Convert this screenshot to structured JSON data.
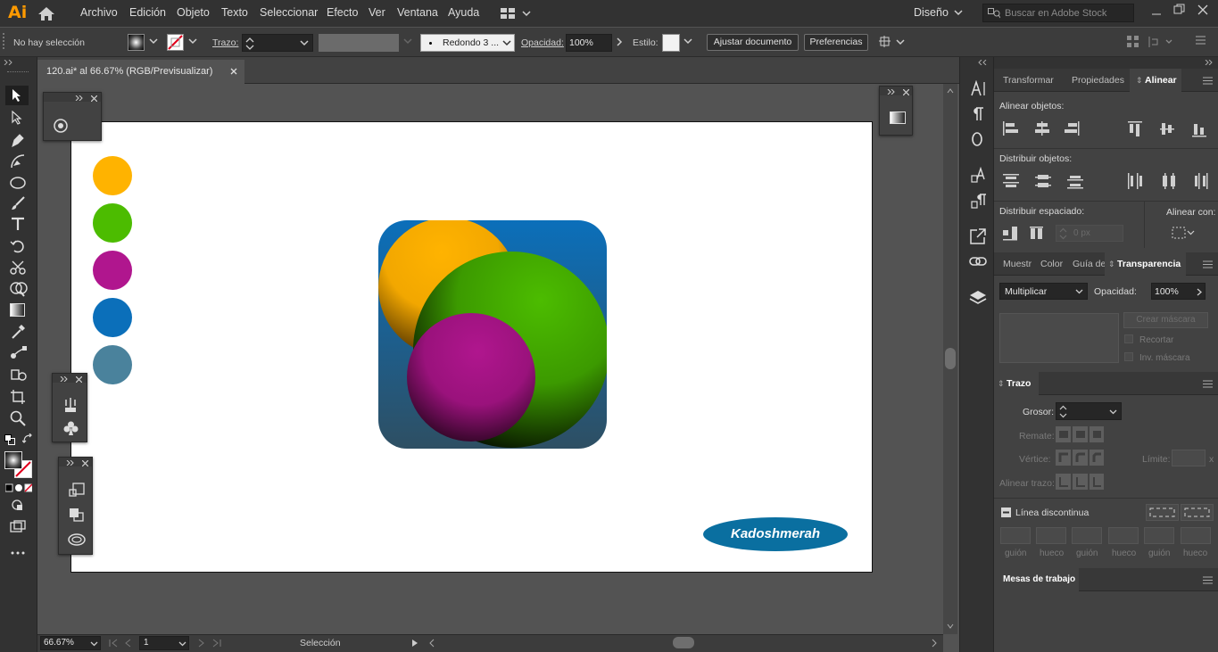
{
  "app": {
    "logo": "Ai"
  },
  "menu": [
    "Archivo",
    "Edición",
    "Objeto",
    "Texto",
    "Seleccionar",
    "Efecto",
    "Ver",
    "Ventana",
    "Ayuda"
  ],
  "workspace": "Diseño",
  "stock_search": {
    "placeholder": "Buscar en Adobe Stock"
  },
  "control": {
    "selection_status": "No hay selección",
    "stroke_label": "Trazo:",
    "brush": "Redondo 3 ...",
    "opacity_label": "Opacidad:",
    "opacity_value": "100%",
    "style_label": "Estilo:",
    "adjust_doc": "Ajustar documento",
    "preferences": "Preferencias"
  },
  "document": {
    "tab_title": "120.ai* al 66.67% (RGB/Previsualizar)"
  },
  "artwork": {
    "swatches": [
      "#ffb300",
      "#4cbc00",
      "#b0168e",
      "#0b6fba",
      "#4a829c"
    ],
    "signature": "Kadoshmerah"
  },
  "status": {
    "zoom": "66.67%",
    "artboard_num": "1",
    "tool": "Selección"
  },
  "panels": {
    "align_tabs": [
      "Transformar",
      "Propiedades",
      "Alinear"
    ],
    "align_objects": "Alinear objetos:",
    "distribute_objects": "Distribuir objetos:",
    "distribute_spacing": "Distribuir espaciado:",
    "align_to": "Alinear con:",
    "spacing_value": "0 px",
    "transp_tabs": [
      "Muestr",
      "Color",
      "Guía de",
      "Transparencia"
    ],
    "blend_mode": "Multiplicar",
    "opacity_label": "Opacidad:",
    "opacity_value": "100%",
    "make_mask": "Crear máscara",
    "clip": "Recortar",
    "invert_mask": "Inv. máscara",
    "stroke_tab": "Trazo",
    "weight_label": "Grosor:",
    "cap_label": "Remate:",
    "corner_label": "Vértice:",
    "limit_label": "Límite:",
    "limit_unit": "x",
    "align_stroke_label": "Alinear trazo:",
    "dashed_line": "Línea discontinua",
    "dash_labels": [
      "guión",
      "hueco",
      "guión",
      "hueco",
      "guión",
      "hueco"
    ],
    "artboards_tab": "Mesas de trabajo"
  }
}
